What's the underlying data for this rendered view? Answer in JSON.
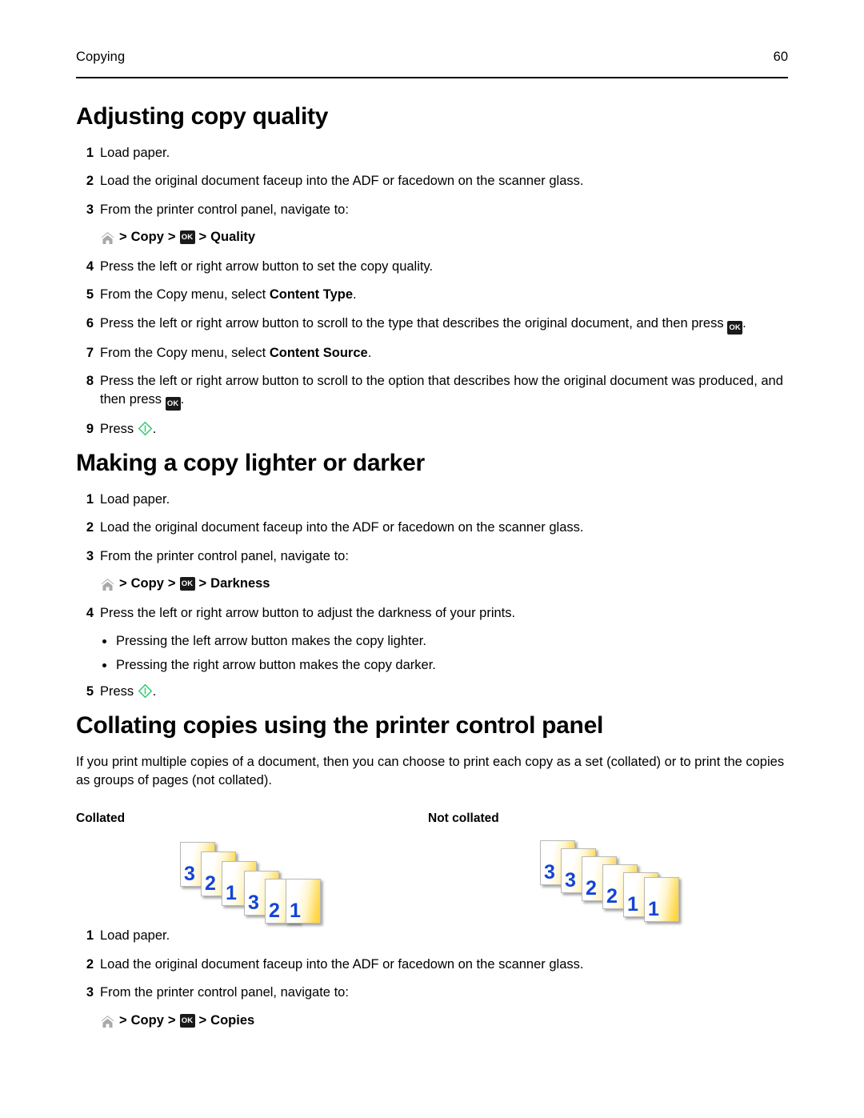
{
  "header": {
    "chapter": "Copying",
    "page_number": "60"
  },
  "icons": {
    "home": "home-icon",
    "ok": "OK",
    "start": "start-icon"
  },
  "sections": [
    {
      "id": "adjusting-copy-quality",
      "heading": "Adjusting copy quality",
      "steps": [
        {
          "num": "1",
          "text": "Load paper."
        },
        {
          "num": "2",
          "text": "Load the original document faceup into the ADF or facedown on the scanner glass."
        },
        {
          "num": "3",
          "text": "From the printer control panel, navigate to:"
        }
      ],
      "navpath": {
        "home_icon": "home-icon",
        "sep": ">",
        "item1": "Copy",
        "ok_label": "OK",
        "item2": "Quality"
      },
      "steps2": [
        {
          "num": "4",
          "text": "Press the left or right arrow button to set the copy quality."
        },
        {
          "num": "5",
          "pre": "From the Copy menu, select ",
          "bold": "Content Type",
          "post": "."
        },
        {
          "num": "6",
          "pre": "Press the left or right arrow button to scroll to the type that describes the original document, and then press ",
          "post": "."
        },
        {
          "num": "7",
          "pre": "From the Copy menu, select ",
          "bold": "Content Source",
          "post": "."
        },
        {
          "num": "8",
          "pre": "Press the left or right arrow button to scroll to the option that describes how the original document was produced, and then press ",
          "post": "."
        },
        {
          "num": "9",
          "pre": "Press ",
          "post": "."
        }
      ]
    },
    {
      "id": "making-a-copy-lighter-or-darker",
      "heading": "Making a copy lighter or darker",
      "steps": [
        {
          "num": "1",
          "text": "Load paper."
        },
        {
          "num": "2",
          "text": "Load the original document faceup into the ADF or facedown on the scanner glass."
        },
        {
          "num": "3",
          "text": "From the printer control panel, navigate to:"
        }
      ],
      "navpath": {
        "home_icon": "home-icon",
        "sep": ">",
        "item1": "Copy",
        "ok_label": "OK",
        "item2": "Darkness"
      },
      "step4": {
        "num": "4",
        "text": "Press the left or right arrow button to adjust the darkness of your prints."
      },
      "bullets": [
        "Pressing the left arrow button makes the copy lighter.",
        "Pressing the right arrow button makes the copy darker."
      ],
      "step5": {
        "num": "5",
        "pre": "Press ",
        "post": "."
      }
    },
    {
      "id": "collating-copies",
      "heading": "Collating copies using the printer control panel",
      "paragraph": "If you print multiple copies of a document, then you can choose to print each copy as a set (collated) or to print the copies as groups of pages (not collated).",
      "figure": {
        "label_collated": "Collated",
        "label_not_collated": "Not collated",
        "collated_sheets": [
          "3",
          "2",
          "1",
          "3",
          "2",
          "1"
        ],
        "not_collated_sheets": [
          "3",
          "3",
          "2",
          "2",
          "1",
          "1"
        ],
        "sheet_number_color": "#1344d6",
        "sheet_fill_color": "#ffd84d"
      },
      "steps": [
        {
          "num": "1",
          "text": "Load paper."
        },
        {
          "num": "2",
          "text": "Load the original document faceup into the ADF or facedown on the scanner glass."
        },
        {
          "num": "3",
          "text": "From the printer control panel, navigate to:"
        }
      ],
      "navpath": {
        "home_icon": "home-icon",
        "sep": ">",
        "item1": "Copy",
        "ok_label": "OK",
        "item2": "Copies"
      }
    }
  ]
}
